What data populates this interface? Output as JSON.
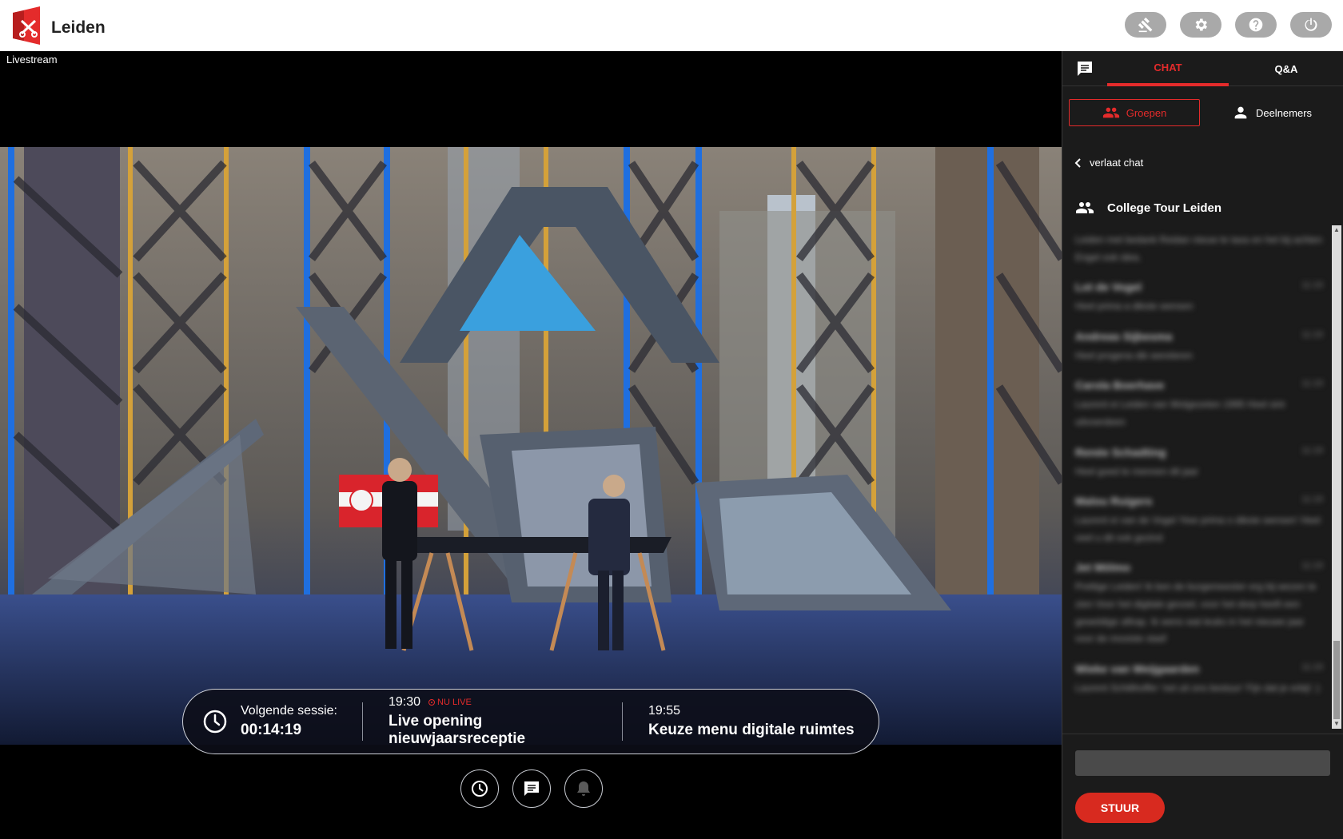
{
  "brand": {
    "name": "Leiden"
  },
  "toolbar": {
    "buttons": [
      {
        "icon": "gavel-icon"
      },
      {
        "icon": "gear-icon"
      },
      {
        "icon": "help-icon"
      },
      {
        "icon": "power-icon"
      }
    ]
  },
  "stage": {
    "label": "Livestream",
    "schedule": {
      "next_label": "Volgende sessie:",
      "countdown": "00:14:19",
      "current": {
        "time": "19:30",
        "badge": "NU LIVE",
        "title": "Live opening nieuwjaarsreceptie"
      },
      "upcoming": {
        "time": "19:55",
        "title": "Keuze menu digitale ruimtes"
      }
    }
  },
  "sidebar": {
    "tabs": {
      "chat": "CHAT",
      "qa": "Q&A"
    },
    "segments": {
      "groups": "Groepen",
      "participants": "Deelnemers"
    },
    "back_label": "verlaat chat",
    "group_name": "College Tour Leiden",
    "messages": [
      {
        "author": "",
        "time": "",
        "text": "Leiden met bedank Reidan nieuw te taxa en het bij achten Engel ook idea."
      },
      {
        "author": "Lot de Vogel",
        "time": "11:19",
        "text": "Heel prima a dikste wensen"
      },
      {
        "author": "Andreas Sijbesma",
        "time": "11:19",
        "text": "Heel progena dik wereleren"
      },
      {
        "author": "Carola Boerhave",
        "time": "11:19",
        "text": "Laurent ei Leiden van Wolgezeten 1995 Heel sint uitvoerdeen"
      },
      {
        "author": "Renée Schadting",
        "time": "11:19",
        "text": "Heel goed te mennen dit jaar"
      },
      {
        "author": "Malou Ruigers",
        "time": "11:19",
        "text": "Laurent ei van de Vogel 'Hoe prima o dikste wensen' Heel veel u dit ook gezind"
      },
      {
        "author": "Jet Mölmo",
        "time": "11:19",
        "text": "Prettige Leiden! Ik ben de burgemeester erg bij wezen te zien Voor het digitale gevoel, voor het dorp heeft een geweldige aftrap. Ik wens wat leuks in het nieuwe jaar voor de mooiste stad!"
      },
      {
        "author": "Wieke van Weijgaarden",
        "time": "11:19",
        "text": "Laurent Schilthoffer 'net uit ons bestuur' Fijn dat je erbij! :)"
      }
    ],
    "composer": {
      "placeholder": "",
      "send_label": "STUUR"
    }
  }
}
